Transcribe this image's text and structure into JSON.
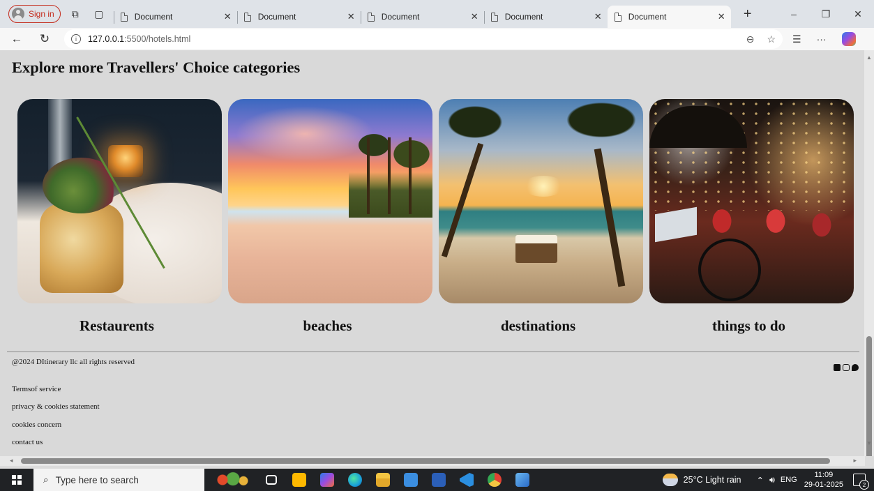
{
  "browser": {
    "profile_label": "Sign in",
    "tabs": [
      {
        "title": "Document",
        "close": "✕"
      },
      {
        "title": "Document",
        "close": "✕"
      },
      {
        "title": "Document",
        "close": "✕"
      },
      {
        "title": "Document",
        "close": "✕"
      },
      {
        "title": "Document",
        "close": "✕"
      }
    ],
    "new_tab_label": "+",
    "url_host": "127.0.0.1",
    "url_tail": ":5500/hotels.html",
    "window_controls": {
      "minimize": "–",
      "restore": "❐",
      "close": "✕"
    }
  },
  "page": {
    "heading": "Explore more Travellers' Choice categories",
    "categories": [
      {
        "label": "Restaurents",
        "image": "restaurant-dish-image"
      },
      {
        "label": "beaches",
        "image": "beach-sunset-image"
      },
      {
        "label": "destinations",
        "image": "tropical-destination-image"
      },
      {
        "label": "things to do",
        "image": "night-market-image"
      }
    ],
    "footer": {
      "copyright": "@2024 DItinerary llc all rights reserved",
      "links": [
        "Termsof service",
        "privacy & cookies statement",
        "cookies concern",
        "contact us"
      ],
      "social_icons": [
        "facebook-icon",
        "instagram-icon",
        "twitter-icon"
      ]
    }
  },
  "taskbar": {
    "search_placeholder": "Type here to search",
    "weather": "25°C  Light rain",
    "language": "ENG",
    "time": "11:09",
    "date": "29-01-2025",
    "apps": [
      {
        "name": "task-view-icon",
        "color": "#ffffff"
      },
      {
        "name": "store-icon",
        "color": "#ffb900"
      },
      {
        "name": "copilot-icon",
        "color": "#9b4be0"
      },
      {
        "name": "edge-icon",
        "color": "#1aa0d8"
      },
      {
        "name": "file-explorer-icon",
        "color": "#f4c542"
      },
      {
        "name": "mail-icon",
        "color": "#3b8ee0"
      },
      {
        "name": "word-icon",
        "color": "#2b5fb8"
      },
      {
        "name": "vscode-icon",
        "color": "#2b8fe0"
      },
      {
        "name": "chrome-icon",
        "color": "#e34133"
      },
      {
        "name": "photos-icon",
        "color": "#3a8ad8"
      }
    ]
  }
}
